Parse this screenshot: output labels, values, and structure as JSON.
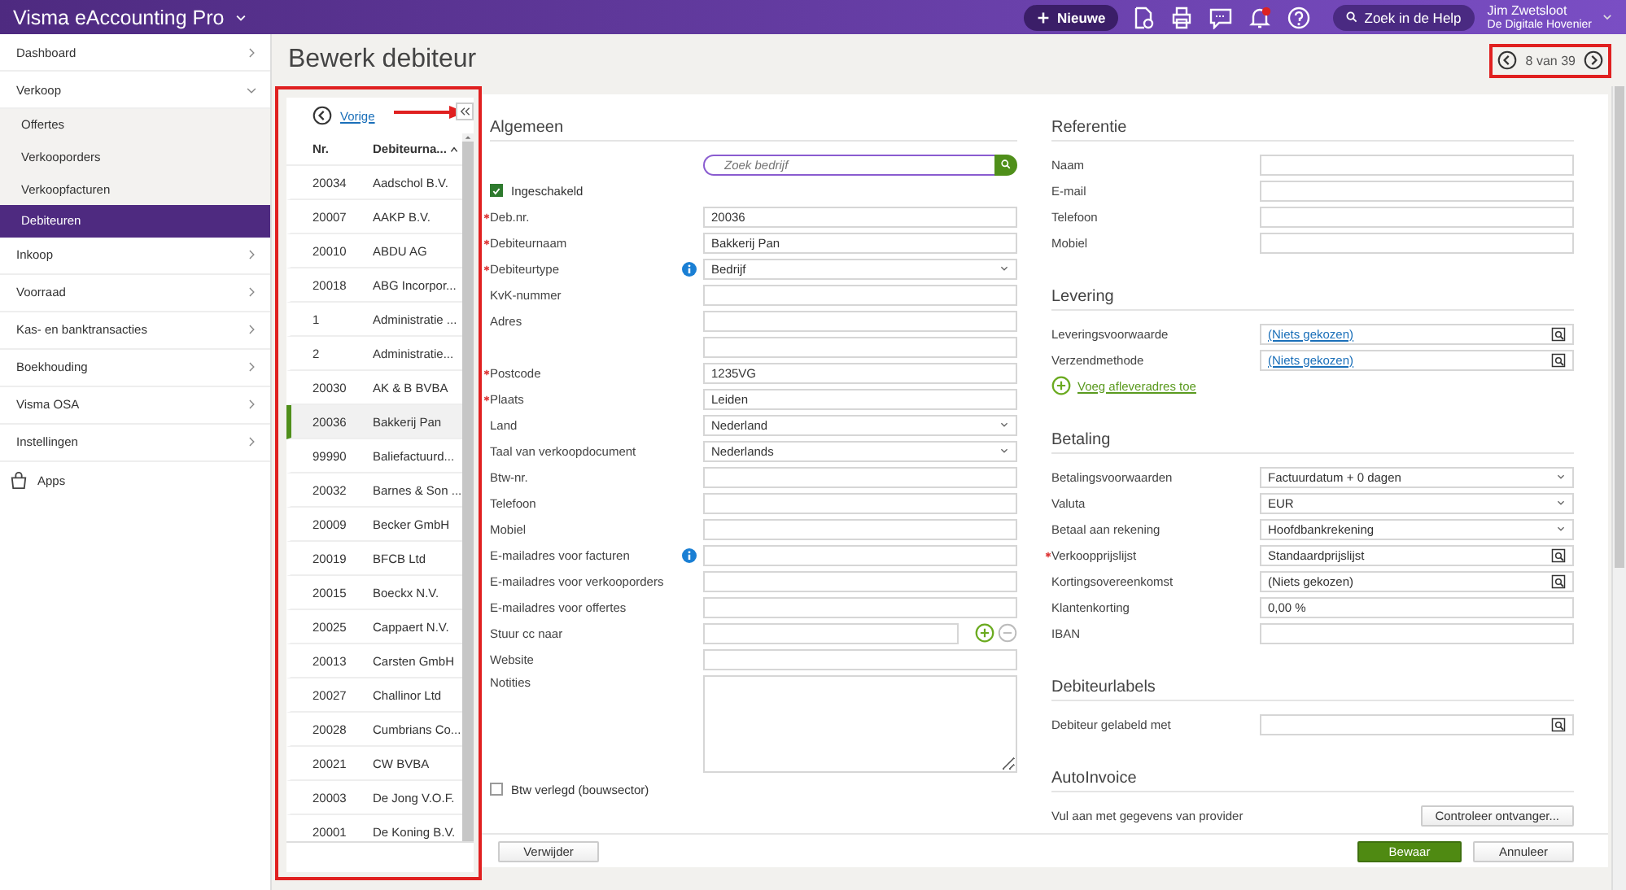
{
  "app": {
    "title": "Visma eAccounting Pro",
    "new_button": "Nieuwe",
    "help_search": "Zoek in de Help",
    "user": {
      "name": "Jim Zwetsloot",
      "company": "De Digitale Hovenier"
    }
  },
  "sidebar": [
    {
      "kind": "menu",
      "label": "Dashboard",
      "expanded": false,
      "selected": false
    },
    {
      "kind": "menu",
      "label": "Verkoop",
      "expanded": true,
      "selected": false,
      "children": [
        {
          "label": "Offertes",
          "selected": false
        },
        {
          "label": "Verkooporders",
          "selected": false
        },
        {
          "label": "Verkoopfacturen",
          "selected": false
        },
        {
          "label": "Debiteuren",
          "selected": true
        }
      ]
    },
    {
      "kind": "menu",
      "label": "Inkoop",
      "expanded": false,
      "selected": false
    },
    {
      "kind": "menu",
      "label": "Voorraad",
      "expanded": false,
      "selected": false
    },
    {
      "kind": "menu",
      "label": "Kas- en banktransacties",
      "expanded": false,
      "selected": false
    },
    {
      "kind": "menu",
      "label": "Boekhouding",
      "expanded": false,
      "selected": false
    },
    {
      "kind": "menu",
      "label": "Visma OSA",
      "expanded": false,
      "selected": false
    },
    {
      "kind": "menu",
      "label": "Instellingen",
      "expanded": false,
      "selected": false
    },
    {
      "kind": "apps",
      "label": "Apps",
      "selected": false
    }
  ],
  "page": {
    "title": "Bewerk debiteur",
    "pager": "8 van 39"
  },
  "list": {
    "back_link": "Vorige",
    "columns": [
      "Nr.",
      "Debiteurna..."
    ],
    "rows": [
      {
        "nr": "20034",
        "name": "Aadschol B.V.",
        "selected": false
      },
      {
        "nr": "20007",
        "name": "AAKP B.V.",
        "selected": false
      },
      {
        "nr": "20010",
        "name": "ABDU AG",
        "selected": false
      },
      {
        "nr": "20018",
        "name": "ABG Incorpor...",
        "selected": false
      },
      {
        "nr": "1",
        "name": "Administratie ...",
        "selected": false
      },
      {
        "nr": "2",
        "name": "Administratie...",
        "selected": false
      },
      {
        "nr": "20030",
        "name": "AK & B BVBA",
        "selected": false
      },
      {
        "nr": "20036",
        "name": "Bakkerij Pan",
        "selected": true
      },
      {
        "nr": "99990",
        "name": "Baliefactuurd...",
        "selected": false
      },
      {
        "nr": "20032",
        "name": "Barnes & Son ...",
        "selected": false
      },
      {
        "nr": "20009",
        "name": "Becker GmbH",
        "selected": false
      },
      {
        "nr": "20019",
        "name": "BFCB Ltd",
        "selected": false
      },
      {
        "nr": "20015",
        "name": "Boeckx N.V.",
        "selected": false
      },
      {
        "nr": "20025",
        "name": "Cappaert N.V.",
        "selected": false
      },
      {
        "nr": "20013",
        "name": "Carsten GmbH",
        "selected": false
      },
      {
        "nr": "20027",
        "name": "Challinor Ltd",
        "selected": false
      },
      {
        "nr": "20028",
        "name": "Cumbrians Co...",
        "selected": false
      },
      {
        "nr": "20021",
        "name": "CW BVBA",
        "selected": false
      },
      {
        "nr": "20003",
        "name": "De Jong V.O.F.",
        "selected": false
      },
      {
        "nr": "20001",
        "name": "De Koning B.V.",
        "selected": false
      }
    ]
  },
  "form": {
    "left": [
      {
        "kind": "heading",
        "label": "Algemeen"
      },
      {
        "kind": "search",
        "placeholder": "Zoek bedrijf"
      },
      {
        "kind": "checkbox",
        "label": "Ingeschakeld",
        "checked": true
      },
      {
        "kind": "text",
        "label": "Deb.nr.",
        "required": true,
        "value": "20036"
      },
      {
        "kind": "text",
        "label": "Debiteurnaam",
        "required": true,
        "value": "Bakkerij Pan"
      },
      {
        "kind": "select",
        "label": "Debiteurtype",
        "required": true,
        "info": true,
        "value": "Bedrijf"
      },
      {
        "kind": "text",
        "label": "KvK-nummer"
      },
      {
        "kind": "text",
        "label": "Adres"
      },
      {
        "kind": "text"
      },
      {
        "kind": "text",
        "label": "Postcode",
        "required": true,
        "value": "1235VG"
      },
      {
        "kind": "text",
        "label": "Plaats",
        "required": true,
        "value": "Leiden"
      },
      {
        "kind": "select",
        "label": "Land",
        "value": "Nederland"
      },
      {
        "kind": "select",
        "label": "Taal van verkoopdocument",
        "value": "Nederlands"
      },
      {
        "kind": "text",
        "label": "Btw-nr."
      },
      {
        "kind": "text",
        "label": "Telefoon"
      },
      {
        "kind": "text",
        "label": "Mobiel"
      },
      {
        "kind": "text",
        "label": "E-mailadres voor facturen",
        "info": true
      },
      {
        "kind": "text",
        "label": "E-mailadres voor verkooporders"
      },
      {
        "kind": "text",
        "label": "E-mailadres voor offertes"
      },
      {
        "kind": "cc",
        "label": "Stuur cc naar"
      },
      {
        "kind": "text",
        "label": "Website"
      },
      {
        "kind": "textarea",
        "label": "Notities"
      },
      {
        "kind": "checkbox",
        "label": "Btw verlegd (bouwsector)",
        "checked": false
      }
    ],
    "right": [
      {
        "kind": "heading",
        "label": "Referentie"
      },
      {
        "kind": "text",
        "label": "Naam"
      },
      {
        "kind": "text",
        "label": "E-mail"
      },
      {
        "kind": "text",
        "label": "Telefoon"
      },
      {
        "kind": "text",
        "label": "Mobiel"
      },
      {
        "kind": "heading",
        "label": "Levering"
      },
      {
        "kind": "lookup",
        "label": "Leveringsvoorwaarde",
        "value": "(Niets gekozen)",
        "link": true
      },
      {
        "kind": "lookup",
        "label": "Verzendmethode",
        "value": "(Niets gekozen)",
        "link": true
      },
      {
        "kind": "addlink",
        "label": "Voeg afleveradres toe"
      },
      {
        "kind": "heading",
        "label": "Betaling"
      },
      {
        "kind": "select",
        "label": "Betalingsvoorwaarden",
        "value": "Factuurdatum + 0 dagen"
      },
      {
        "kind": "select",
        "label": "Valuta",
        "value": "EUR"
      },
      {
        "kind": "select",
        "label": "Betaal aan rekening",
        "value": "Hoofdbankrekening"
      },
      {
        "kind": "lookup",
        "label": "Verkoopprijslijst",
        "required": true,
        "value": "Standaardprijslijst",
        "link": false
      },
      {
        "kind": "lookup",
        "label": "Kortingsovereenkomst",
        "value": "(Niets gekozen)",
        "link": false
      },
      {
        "kind": "text",
        "label": "Klantenkorting",
        "value": "0,00 %"
      },
      {
        "kind": "text",
        "label": "IBAN"
      },
      {
        "kind": "heading",
        "label": "Debiteurlabels"
      },
      {
        "kind": "lookup",
        "label": "Debiteur gelabeld met"
      },
      {
        "kind": "heading",
        "label": "AutoInvoice"
      },
      {
        "kind": "button",
        "label": "Vul aan met gegevens van provider",
        "button": "Controleer ontvanger..."
      }
    ]
  },
  "footer": {
    "left": [
      {
        "label": "Verwijder",
        "kind": "secondary"
      }
    ],
    "right": [
      {
        "label": "Bewaar",
        "kind": "primary"
      },
      {
        "label": "Annuleer",
        "kind": "secondary"
      }
    ]
  }
}
